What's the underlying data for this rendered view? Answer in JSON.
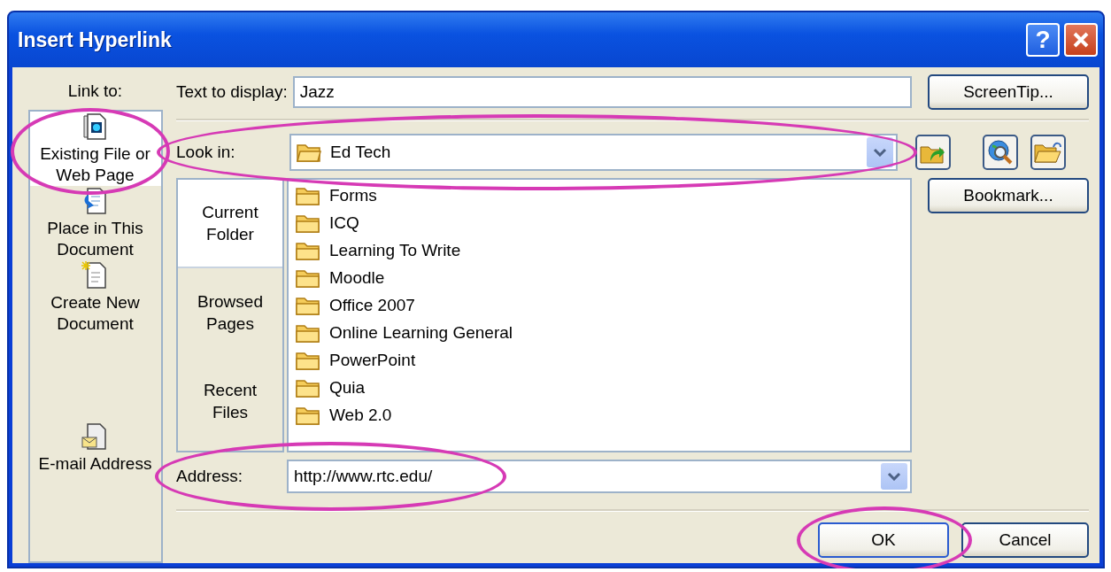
{
  "window": {
    "title": "Insert Hyperlink",
    "help": "?"
  },
  "link_to": {
    "label": "Link to:",
    "items": [
      {
        "label": "Existing File or\nWeb Page",
        "kind": "file",
        "selected": true,
        "highlighted": true
      },
      {
        "label": "Place in This\nDocument",
        "kind": "place",
        "selected": false,
        "highlighted": false
      },
      {
        "label": "Create New\nDocument",
        "kind": "new",
        "selected": false,
        "highlighted": false
      },
      {
        "label": "E-mail Address",
        "kind": "email",
        "selected": false,
        "highlighted": false
      }
    ]
  },
  "text_to_display": {
    "label": "Text to display:",
    "value": "Jazz"
  },
  "look_in": {
    "label": "Look in:",
    "value": "Ed Tech",
    "highlighted": true
  },
  "browse_tabs": [
    {
      "label": "Current\nFolder",
      "selected": true
    },
    {
      "label": "Browsed\nPages",
      "selected": false
    },
    {
      "label": "Recent\nFiles",
      "selected": false
    }
  ],
  "files": [
    "Forms",
    "ICQ",
    "Learning To Write",
    "Moodle",
    "Office 2007",
    "Online Learning General",
    "PowerPoint",
    "Quia",
    "Web 2.0"
  ],
  "address": {
    "label": "Address:",
    "value": "http://www.rtc.edu/",
    "highlighted": true
  },
  "buttons": {
    "screentip": {
      "label": "ScreenTip..."
    },
    "bookmark": {
      "label": "Bookmark..."
    },
    "ok": {
      "label": "OK",
      "highlighted": true
    },
    "cancel": {
      "label": "Cancel"
    }
  }
}
